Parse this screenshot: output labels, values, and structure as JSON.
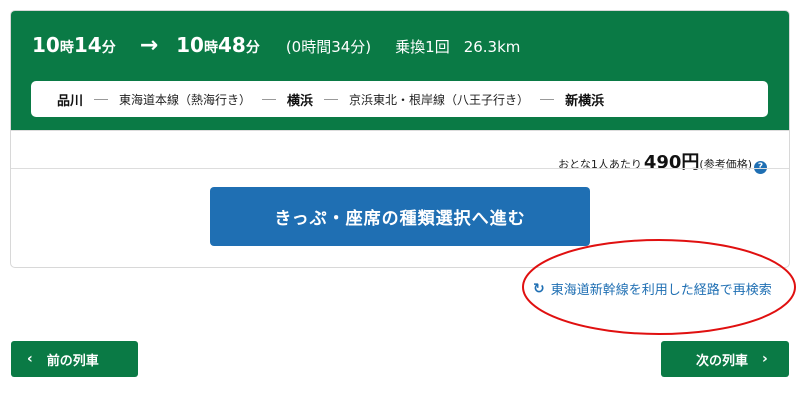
{
  "summary": {
    "depart_hour": "10",
    "depart_min": "14",
    "arrive_hour": "10",
    "arrive_min": "48",
    "hour_unit": "時",
    "min_unit": "分",
    "arrow": "→",
    "duration": "(0時間34分)",
    "transfers": "乗換1回",
    "distance": "26.3km"
  },
  "route": {
    "station_1": "品川",
    "line_1": "東海道本線（熱海行き）",
    "station_2": "横浜",
    "line_2": "京浜東北・根岸線（八王子行き）",
    "station_3": "新横浜"
  },
  "price": {
    "label": "おとな1人あたり",
    "value": "490円",
    "note": "(参考価格)",
    "help_glyph": "?"
  },
  "actions": {
    "proceed_label": "きっぷ・座席の種類選択へ進む",
    "research_label": "東海道新幹線を利用した経路で再検索",
    "refresh_glyph": "↻"
  },
  "nav": {
    "prev_label": "前の列車",
    "next_label": "次の列車",
    "prev_glyph": "‹",
    "next_glyph": "›"
  },
  "colors": {
    "brand_green": "#0a7a45",
    "link_blue": "#1f6fb3",
    "highlight_red": "#e01010"
  },
  "icons": {
    "help": "question-circle-icon",
    "refresh": "refresh-icon",
    "prev": "chevron-left-icon",
    "next": "chevron-right-icon"
  }
}
